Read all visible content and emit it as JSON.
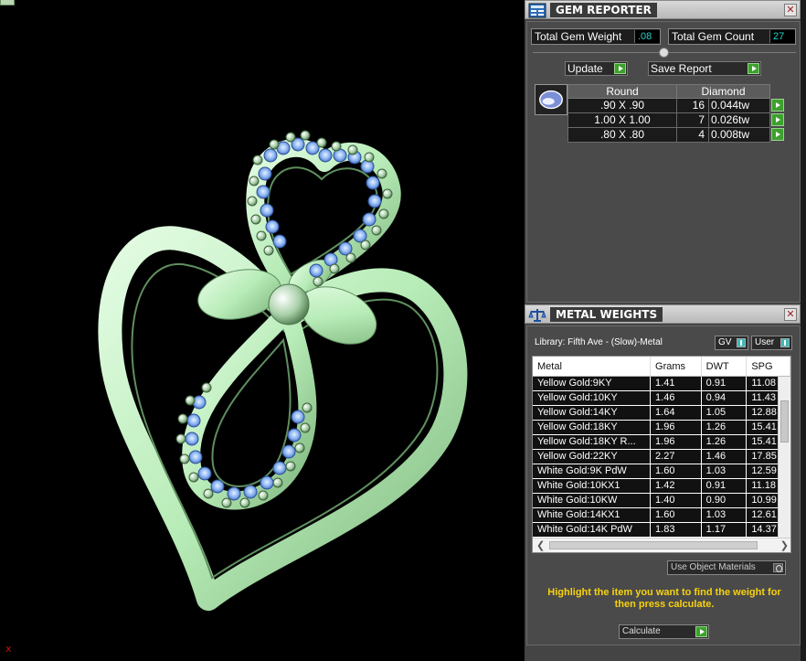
{
  "gem_reporter": {
    "title": "GEM REPORTER",
    "close_symbol": "✕",
    "total_weight_label": "Total Gem Weight",
    "total_weight_value": ".08",
    "total_count_label": "Total Gem Count",
    "total_count_value": "27",
    "update_label": "Update",
    "save_report_label": "Save Report",
    "table_headers": [
      "Round",
      "Diamond"
    ],
    "rows": [
      {
        "size": ".90 X .90",
        "count": "16",
        "weight": "0.044tw"
      },
      {
        "size": "1.00 X 1.00",
        "count": "7",
        "weight": "0.026tw"
      },
      {
        "size": ".80 X .80",
        "count": "4",
        "weight": "0.008tw"
      }
    ]
  },
  "metal_weights": {
    "title": "METAL WEIGHTS",
    "close_symbol": "✕",
    "library_text": "Library: Fifth Ave - (Slow)-Metal",
    "gv_label": "GV",
    "user_label": "User",
    "columns": [
      "Metal",
      "Grams",
      "DWT",
      "SPG"
    ],
    "rows": [
      {
        "metal": "Yellow Gold:9KY",
        "grams": "1.41",
        "dwt": "0.91",
        "spg": "11.08"
      },
      {
        "metal": "Yellow Gold:10KY",
        "grams": "1.46",
        "dwt": "0.94",
        "spg": "11.43"
      },
      {
        "metal": "Yellow Gold:14KY",
        "grams": "1.64",
        "dwt": "1.05",
        "spg": "12.88"
      },
      {
        "metal": "Yellow Gold:18KY",
        "grams": "1.96",
        "dwt": "1.26",
        "spg": "15.41"
      },
      {
        "metal": "Yellow Gold:18KY R...",
        "grams": "1.96",
        "dwt": "1.26",
        "spg": "15.41"
      },
      {
        "metal": "Yellow Gold:22KY",
        "grams": "2.27",
        "dwt": "1.46",
        "spg": "17.85"
      },
      {
        "metal": "White Gold:9K PdW",
        "grams": "1.60",
        "dwt": "1.03",
        "spg": "12.59"
      },
      {
        "metal": "White Gold:10KX1",
        "grams": "1.42",
        "dwt": "0.91",
        "spg": "11.18"
      },
      {
        "metal": "White Gold:10KW",
        "grams": "1.40",
        "dwt": "0.90",
        "spg": "10.99"
      },
      {
        "metal": "White Gold:14KX1",
        "grams": "1.60",
        "dwt": "1.03",
        "spg": "12.61"
      },
      {
        "metal": "White Gold:14K PdW",
        "grams": "1.83",
        "dwt": "1.17",
        "spg": "14.37"
      }
    ],
    "use_object_materials_label": "Use Object Materials",
    "hint_text": "Highlight the item you want to find the weight for then press calculate.",
    "calculate_label": "Calculate"
  },
  "viewport": {
    "axis_label": "x",
    "metal_color": "#c6f2c6",
    "gem_color": "#8ab4f2"
  }
}
